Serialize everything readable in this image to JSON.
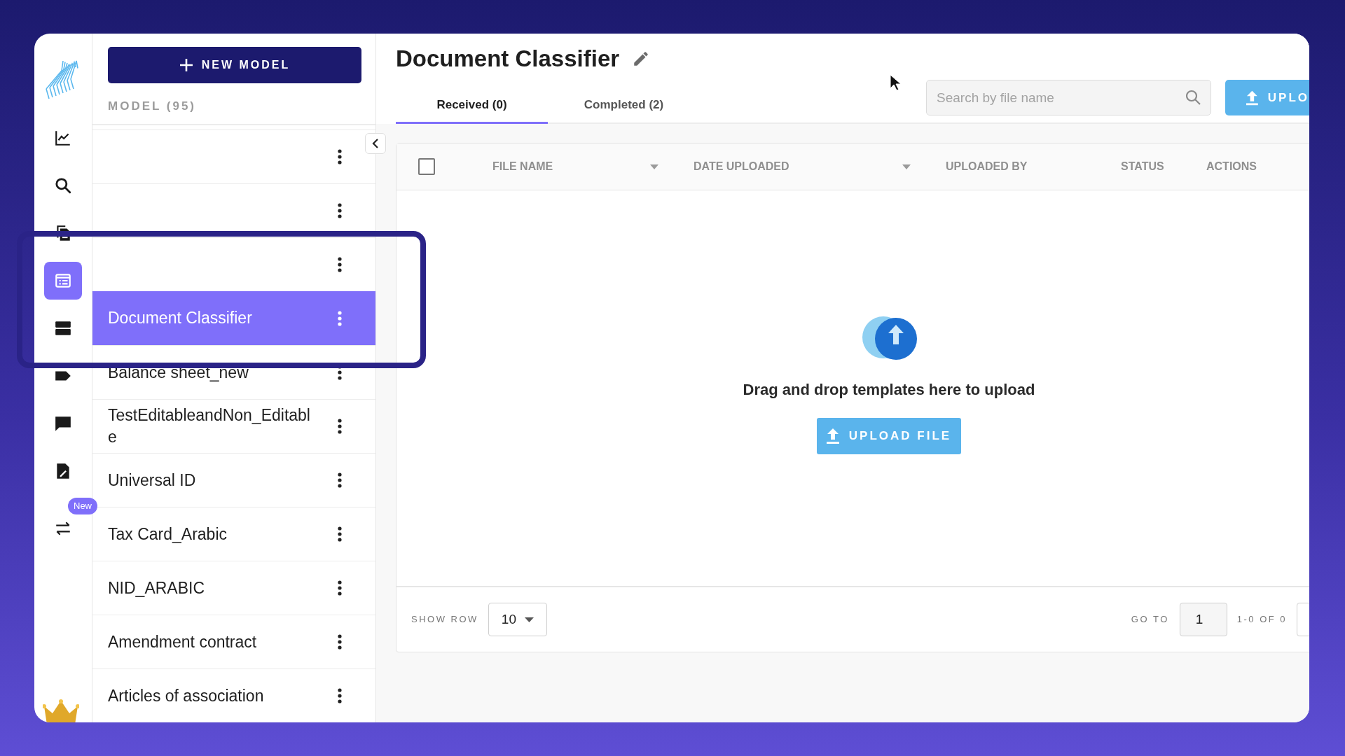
{
  "nav_items": [
    {
      "selected": false
    },
    {
      "selected": false
    },
    {
      "selected": false
    },
    {
      "selected": true
    },
    {
      "selected": false
    },
    {
      "selected": false
    },
    {
      "selected": false
    },
    {
      "selected": false
    },
    {
      "selected": false,
      "badge": "New"
    }
  ],
  "new_model_button": "NEW MODEL",
  "model_list": {
    "heading": "MODEL (95)",
    "items": [
      {
        "selected": false
      },
      {
        "selected": false
      },
      {
        "selected": false
      },
      {
        "name": "Document Classifier",
        "selected": true
      },
      {
        "name": "Balance sheet_new",
        "selected": false
      },
      {
        "name": "TestEditableandNon_Editable",
        "selected": false
      },
      {
        "name": "Universal ID",
        "selected": false
      },
      {
        "name": "Tax Card_Arabic",
        "selected": false
      },
      {
        "name": "NID_ARABIC",
        "selected": false
      },
      {
        "name": "Amendment contract",
        "selected": false
      },
      {
        "name": "Articles of association",
        "selected": false
      }
    ]
  },
  "page": {
    "title": "Document Classifier",
    "tabs": [
      {
        "label": "Received (0)",
        "selected": true
      },
      {
        "label": "Completed (2)",
        "selected": false
      }
    ],
    "search": {
      "placeholder": "Search by file name"
    },
    "upload_button": "UPLO",
    "table": {
      "select_all": {
        "checked": false
      },
      "columns": [
        {
          "label": "FILE NAME",
          "sortable": true
        },
        {
          "label": "DATE UPLOADED",
          "sortable": true
        },
        {
          "label": "UPLOADED BY",
          "sortable": false
        },
        {
          "label": "STATUS",
          "sortable": false
        },
        {
          "label": "ACTIONS",
          "sortable": false
        }
      ],
      "empty_state": {
        "message": "Drag and drop templates here to upload",
        "button": "UPLOAD FILE"
      },
      "footer": {
        "show_row_label": "SHOW ROW",
        "rows_value": "10",
        "go_to_label": "GO TO",
        "page_value": "1",
        "range": "1-0 OF 0"
      }
    }
  }
}
